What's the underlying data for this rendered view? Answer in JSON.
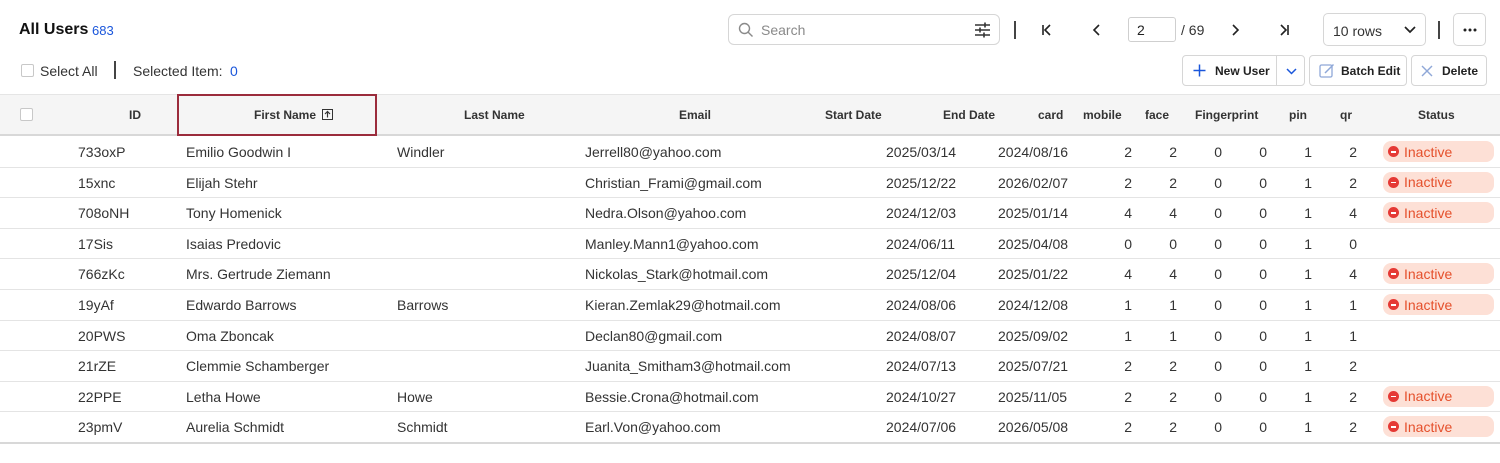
{
  "header": {
    "title": "All Users",
    "count": "683",
    "search_placeholder": "Search",
    "current_page": "2",
    "total_pages": "/ 69",
    "rows_per_page": "10 rows"
  },
  "selection": {
    "select_all_label": "Select All",
    "selected_label": "Selected Item:",
    "selected_count": "0"
  },
  "actions": {
    "new_user": "New User",
    "batch_edit": "Batch Edit",
    "delete": "Delete"
  },
  "columns": {
    "id": "ID",
    "first_name": "First Name",
    "last_name": "Last Name",
    "email": "Email",
    "start_date": "Start Date",
    "end_date": "End Date",
    "card": "card",
    "mobile": "mobile",
    "face": "face",
    "fingerprint": "Fingerprint",
    "pin": "pin",
    "qr": "qr",
    "status": "Status"
  },
  "sort": {
    "column": "First Name",
    "direction": "ascending"
  },
  "colors": {
    "accent": "#1a56db",
    "inactive_bg": "#fde0d6",
    "inactive_text": "#e5502c",
    "sort_highlight": "#9b2c3c"
  },
  "rows": [
    {
      "id": "733oxP",
      "first": "Emilio Goodwin I",
      "last": "Windler",
      "email": "Jerrell80@yahoo.com",
      "start": "2025/03/14",
      "end": "2024/08/16",
      "card": "2",
      "mobile": "2",
      "face": "0",
      "fingerprint": "0",
      "pin": "1",
      "qr": "2",
      "status": "Inactive"
    },
    {
      "id": "15xnc",
      "first": "Elijah Stehr",
      "last": "",
      "email": "Christian_Frami@gmail.com",
      "start": "2025/12/22",
      "end": "2026/02/07",
      "card": "2",
      "mobile": "2",
      "face": "0",
      "fingerprint": "0",
      "pin": "1",
      "qr": "2",
      "status": "Inactive"
    },
    {
      "id": "708oNH",
      "first": "Tony Homenick",
      "last": "",
      "email": "Nedra.Olson@yahoo.com",
      "start": "2024/12/03",
      "end": "2025/01/14",
      "card": "4",
      "mobile": "4",
      "face": "0",
      "fingerprint": "0",
      "pin": "1",
      "qr": "4",
      "status": "Inactive"
    },
    {
      "id": "17Sis",
      "first": "Isaias Predovic",
      "last": "",
      "email": "Manley.Mann1@yahoo.com",
      "start": "2024/06/11",
      "end": "2025/04/08",
      "card": "0",
      "mobile": "0",
      "face": "0",
      "fingerprint": "0",
      "pin": "1",
      "qr": "0",
      "status": ""
    },
    {
      "id": "766zKc",
      "first": "Mrs. Gertrude Ziemann",
      "last": "",
      "email": "Nickolas_Stark@hotmail.com",
      "start": "2025/12/04",
      "end": "2025/01/22",
      "card": "4",
      "mobile": "4",
      "face": "0",
      "fingerprint": "0",
      "pin": "1",
      "qr": "4",
      "status": "Inactive"
    },
    {
      "id": "19yAf",
      "first": "Edwardo Barrows",
      "last": "Barrows",
      "email": "Kieran.Zemlak29@hotmail.com",
      "start": "2024/08/06",
      "end": "2024/12/08",
      "card": "1",
      "mobile": "1",
      "face": "0",
      "fingerprint": "0",
      "pin": "1",
      "qr": "1",
      "status": "Inactive"
    },
    {
      "id": "20PWS",
      "first": "Oma Zboncak",
      "last": "",
      "email": "Declan80@gmail.com",
      "start": "2024/08/07",
      "end": "2025/09/02",
      "card": "1",
      "mobile": "1",
      "face": "0",
      "fingerprint": "0",
      "pin": "1",
      "qr": "1",
      "status": ""
    },
    {
      "id": "21rZE",
      "first": "Clemmie Schamberger",
      "last": "",
      "email": "Juanita_Smitham3@hotmail.com",
      "start": "2024/07/13",
      "end": "2025/07/21",
      "card": "2",
      "mobile": "2",
      "face": "0",
      "fingerprint": "0",
      "pin": "1",
      "qr": "2",
      "status": ""
    },
    {
      "id": "22PPE",
      "first": "Letha Howe",
      "last": "Howe",
      "email": "Bessie.Crona@hotmail.com",
      "start": "2024/10/27",
      "end": "2025/11/05",
      "card": "2",
      "mobile": "2",
      "face": "0",
      "fingerprint": "0",
      "pin": "1",
      "qr": "2",
      "status": "Inactive"
    },
    {
      "id": "23pmV",
      "first": "Aurelia Schmidt",
      "last": "Schmidt",
      "email": "Earl.Von@yahoo.com",
      "start": "2024/07/06",
      "end": "2026/05/08",
      "card": "2",
      "mobile": "2",
      "face": "0",
      "fingerprint": "0",
      "pin": "1",
      "qr": "2",
      "status": "Inactive"
    }
  ]
}
